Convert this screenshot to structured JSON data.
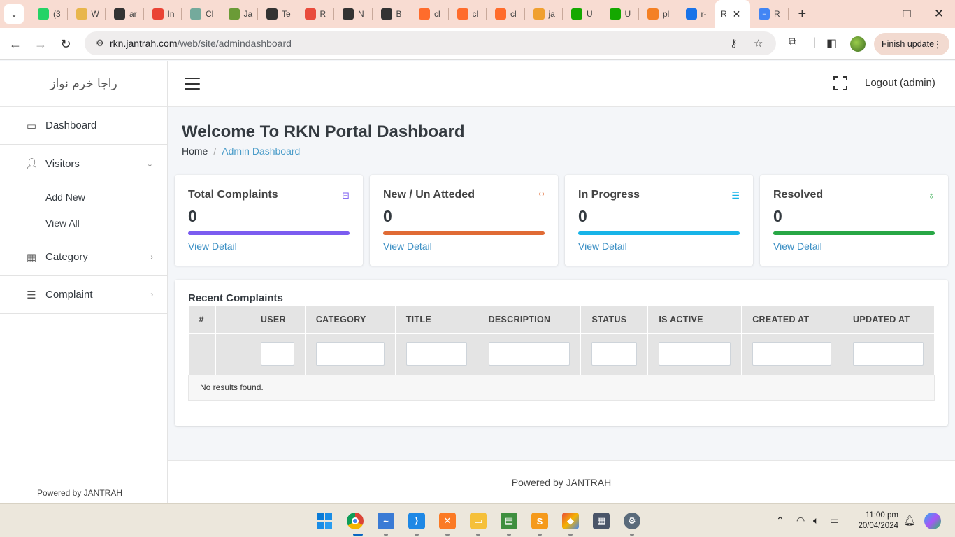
{
  "browser": {
    "tabs": [
      {
        "label": "(3",
        "icon": "whatsapp-icon",
        "color": "#25d366"
      },
      {
        "label": "W",
        "icon": "folder-icon",
        "color": "#e8b64c"
      },
      {
        "label": "ar",
        "icon": "github-icon",
        "color": "#333333"
      },
      {
        "label": "In",
        "icon": "gmail-icon",
        "color": "#ea4335"
      },
      {
        "label": "Cl",
        "icon": "chatgpt-icon",
        "color": "#74aa9c"
      },
      {
        "label": "Ja",
        "icon": "chatgpt-icon",
        "color": "#6b9b37"
      },
      {
        "label": "Te",
        "icon": "github-icon",
        "color": "#333333"
      },
      {
        "label": "R",
        "icon": "grid-icon",
        "color": "#e94b3c"
      },
      {
        "label": "N",
        "icon": "github-icon",
        "color": "#333333"
      },
      {
        "label": "B",
        "icon": "github-icon",
        "color": "#333333"
      },
      {
        "label": "cl",
        "icon": "cpanel-icon",
        "color": "#ff6c2c"
      },
      {
        "label": "cl",
        "icon": "cpanel-icon",
        "color": "#ff6c2c"
      },
      {
        "label": "cl",
        "icon": "cpanel-icon",
        "color": "#ff6c2c"
      },
      {
        "label": "ja",
        "icon": "phpmyadmin-icon",
        "color": "#f0a030"
      },
      {
        "label": "U",
        "icon": "upwork-icon",
        "color": "#14a800"
      },
      {
        "label": "U",
        "icon": "upwork-icon",
        "color": "#14a800"
      },
      {
        "label": "pl",
        "icon": "stackoverflow-icon",
        "color": "#f48024"
      },
      {
        "label": "r-",
        "icon": "shield-icon",
        "color": "#1a73e8"
      }
    ],
    "active_tab_label": "R",
    "last_tab_label": "R",
    "url_host": "rkn.jantrah.com",
    "url_path": "/web/site/admindashboard",
    "finish_update": "Finish update"
  },
  "sidebar": {
    "brand": "راجا خرم نواز",
    "items": [
      {
        "label": "Dashboard",
        "icon": "monitor-icon"
      },
      {
        "label": "Visitors",
        "icon": "user-icon",
        "sub": [
          "Add New",
          "View All"
        ]
      },
      {
        "label": "Category",
        "icon": "grid-icon"
      },
      {
        "label": "Complaint",
        "icon": "list-icon"
      }
    ],
    "footer": "Powered by JANTRAH"
  },
  "header": {
    "logout": "Logout (admin)"
  },
  "content": {
    "title": "Welcome To RKN Portal Dashboard",
    "breadcrumb": {
      "home": "Home",
      "current": "Admin Dashboard"
    },
    "cards": [
      {
        "title": "Total Complaints",
        "value": "0",
        "link": "View Detail",
        "icon": "inbox-icon",
        "color": "#7b5cf0"
      },
      {
        "title": "New / Un Atteded",
        "value": "0",
        "link": "View Detail",
        "icon": "circle-icon",
        "color": "#e06b35"
      },
      {
        "title": "In Progress",
        "value": "0",
        "link": "View Detail",
        "icon": "list-icon",
        "color": "#17b4e8"
      },
      {
        "title": "Resolved",
        "value": "0",
        "link": "View Detail",
        "icon": "award-icon",
        "color": "#28a745"
      }
    ],
    "recent": {
      "title": "Recent Complaints",
      "columns": [
        "#",
        "",
        "USER",
        "CATEGORY",
        "TITLE",
        "DESCRIPTION",
        "STATUS",
        "IS ACTIVE",
        "CREATED AT",
        "UPDATED AT"
      ],
      "empty": "No results found."
    }
  },
  "footer": "Powered by JANTRAH",
  "taskbar": {
    "time": "11:00 pm",
    "date": "20/04/2024"
  }
}
